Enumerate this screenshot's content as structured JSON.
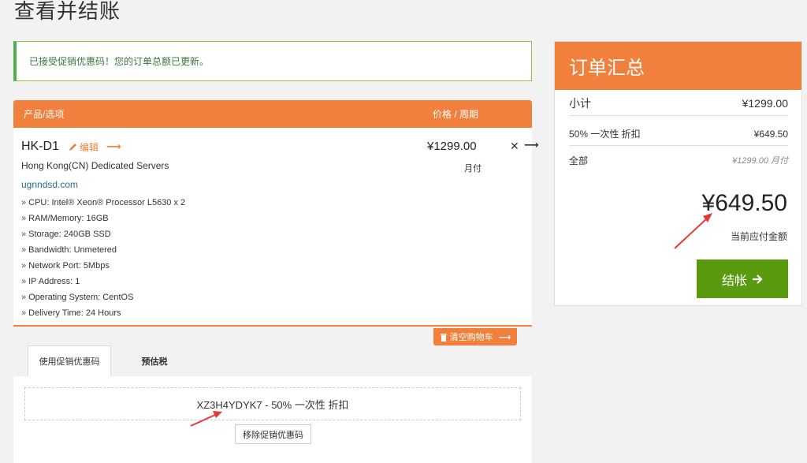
{
  "page": {
    "title": "查看并结账"
  },
  "alert": {
    "message": "已接受促销优惠码！您的订单总额已更新。"
  },
  "cart": {
    "header_product": "产品/选项",
    "header_price": "价格 / 周期",
    "item": {
      "name": "HK-D1",
      "edit_label": "编辑",
      "group": "Hong Kong(CN) Dedicated Servers",
      "domain": "ugnndsd.com",
      "options": [
        "CPU: Intel® Xeon® Processor L5630 x 2",
        "RAM/Memory: 16GB",
        "Storage: 240GB SSD",
        "Bandwidth: Unmetered",
        "Network Port: 5Mbps",
        "IP Address: 1",
        "Operating System: CentOS",
        "Delivery Time: 24 Hours"
      ],
      "price": "¥1299.00",
      "cycle": "月付"
    },
    "empty_label": "清空购物车"
  },
  "tabs": {
    "promo": "使用促销优惠码",
    "tax": "预估税"
  },
  "promo": {
    "applied": "XZ3H4YDYK7 - 50% 一次性 折扣",
    "remove_label": "移除促销优惠码"
  },
  "summary": {
    "title": "订单汇总",
    "subtotal_label": "小计",
    "subtotal_value": "¥1299.00",
    "discount_label": "50% 一次性 折扣",
    "discount_value": "¥649.50",
    "total_label": "全部",
    "total_value": "¥1299.00 月付",
    "due_amount": "¥649.50",
    "due_label": "当前应付金额",
    "checkout_label": "结帐"
  },
  "colors": {
    "accent": "#f0803c",
    "success": "#4caf50",
    "checkout": "#5a9a0e",
    "annotation": "#e53935"
  },
  "icons": {
    "edit": "pencil-icon",
    "remove": "close-icon",
    "empty": "trash-icon",
    "checkout": "arrow-right-icon"
  }
}
